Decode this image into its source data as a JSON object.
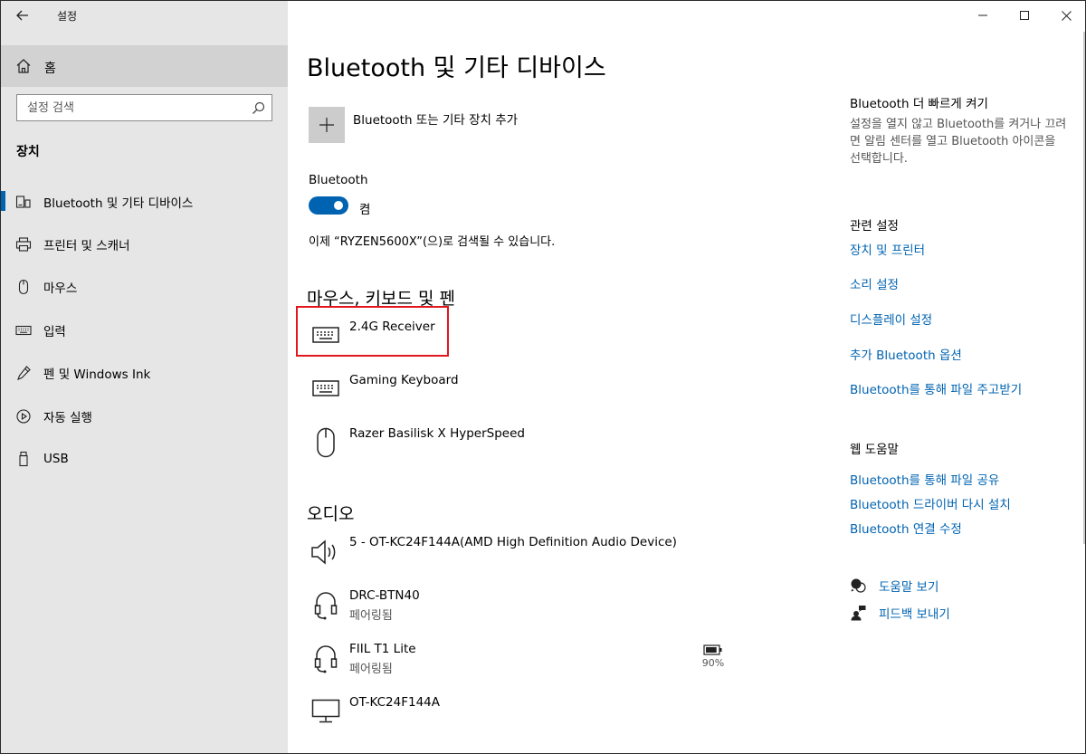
{
  "window": {
    "title": "설정",
    "back_icon": "arrow-left-icon",
    "controls": [
      "minimize-icon",
      "maximize-icon",
      "close-icon"
    ]
  },
  "sidebar": {
    "home_label": "홈",
    "search_placeholder": "설정 검색",
    "section_title": "장치",
    "items": [
      {
        "label": "Bluetooth 및 기타 디바이스",
        "icon": "bluetooth-devices-icon",
        "active": true
      },
      {
        "label": "프린터 및 스캐너",
        "icon": "printer-icon",
        "active": false
      },
      {
        "label": "마우스",
        "icon": "mouse-icon",
        "active": false
      },
      {
        "label": "입력",
        "icon": "keyboard-icon",
        "active": false
      },
      {
        "label": "펜 및 Windows Ink",
        "icon": "pen-icon",
        "active": false
      },
      {
        "label": "자동 실행",
        "icon": "autoplay-icon",
        "active": false
      },
      {
        "label": "USB",
        "icon": "usb-icon",
        "active": false
      }
    ]
  },
  "main": {
    "title": "Bluetooth 및 기타 디바이스",
    "add_device_label": "Bluetooth 또는 기타 장치 추가",
    "bluetooth_label": "Bluetooth",
    "bluetooth_state": "켬",
    "bluetooth_on": true,
    "discoverable_text": "이제 “RYZEN5600X”(으)로 검색될 수 있습니다.",
    "groups": [
      {
        "heading": "마우스, 키보드 및 펜",
        "devices": [
          {
            "name": "2.4G Receiver",
            "icon": "keyboard-icon"
          },
          {
            "name": "Gaming Keyboard",
            "icon": "keyboard-icon"
          },
          {
            "name": "Razer Basilisk X HyperSpeed",
            "icon": "mouse-icon"
          }
        ]
      },
      {
        "heading": "오디오",
        "devices": [
          {
            "name": "5 - OT-KC24F144A(AMD High Definition Audio Device)",
            "icon": "speaker-icon"
          },
          {
            "name": "DRC-BTN40",
            "status": "페어링됨",
            "icon": "headset-icon"
          },
          {
            "name": "FIIL T1 Lite",
            "status": "페어링됨",
            "icon": "headset-icon",
            "battery": "90%",
            "battery_level": 0.9
          },
          {
            "name": "OT-KC24F144A",
            "icon": "monitor-icon"
          }
        ]
      }
    ],
    "highlight_color": "#e1171d",
    "accent_color": "#0063b1"
  },
  "right": {
    "quick_title": "Bluetooth 더 빠르게 켜기",
    "quick_text": "설정을 열지 않고 Bluetooth를 켜거나 끄려면 알림 센터를 열고 Bluetooth 아이콘을 선택합니다.",
    "related_title": "관련 설정",
    "related_links": [
      "장치 및 프린터",
      "소리 설정",
      "디스플레이 설정",
      "추가 Bluetooth 옵션",
      "Bluetooth를 통해 파일 주고받기"
    ],
    "web_help_title": "웹 도움말",
    "web_help_links": [
      "Bluetooth를 통해 파일 공유",
      "Bluetooth 드라이버 다시 설치",
      "Bluetooth 연결 수정"
    ],
    "actions": [
      {
        "label": "도움말 보기",
        "icon": "help-chat-icon"
      },
      {
        "label": "피드백 보내기",
        "icon": "feedback-icon"
      }
    ]
  }
}
